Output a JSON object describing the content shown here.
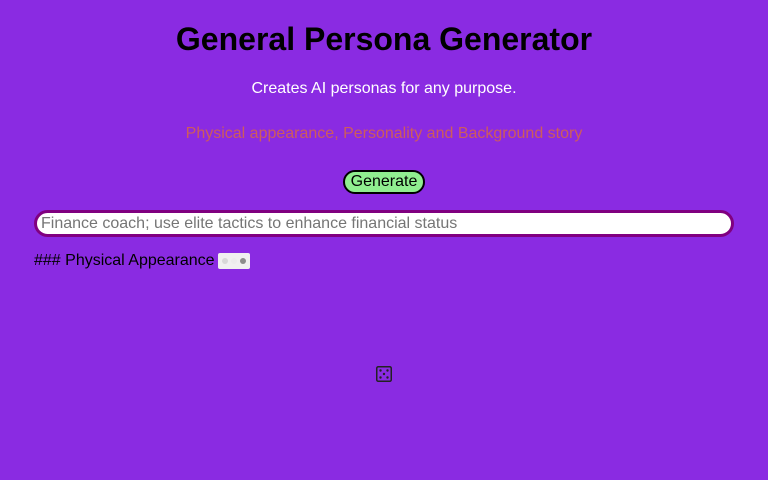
{
  "header": {
    "title": "General Persona Generator",
    "subtitle": "Creates AI personas for any purpose.",
    "tagline": "Physical appearance, Personality and Background story"
  },
  "controls": {
    "generate_label": "Generate",
    "prompt_placeholder": "Finance coach; use elite tactics to enhance financial status",
    "prompt_value": ""
  },
  "output": {
    "text": "### Physical Appearance",
    "loading_icon": "loading-dots-icon"
  },
  "footer": {
    "icon": "dice-icon"
  },
  "colors": {
    "background": "#8a2be2",
    "tagline": "#cd5c5c",
    "button": "#90ee90",
    "input_border": "#800080"
  }
}
